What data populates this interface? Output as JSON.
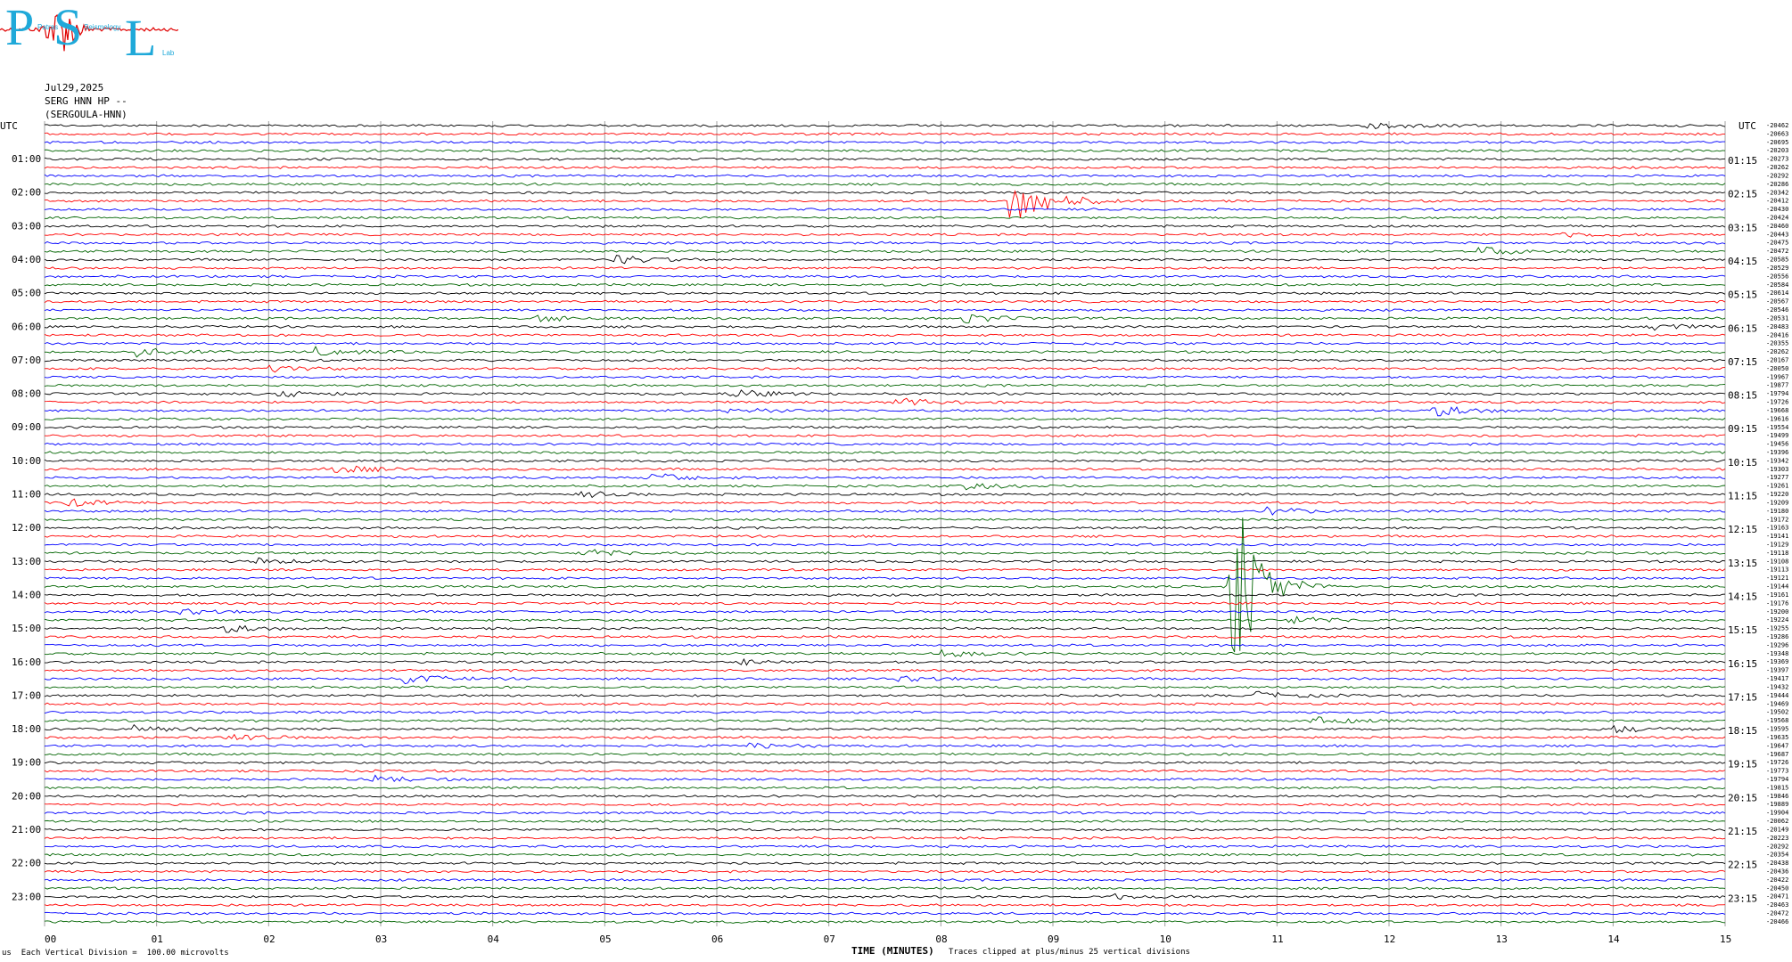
{
  "logo": {
    "letters": [
      "P",
      "S",
      "L"
    ],
    "subtext": [
      "Patras",
      "Seismology",
      "Lab"
    ],
    "colors": {
      "letters": "#1fa9d9",
      "trace": "#e00000"
    }
  },
  "header": {
    "date": "Jul29,2025",
    "station": "SERG HNN HP --",
    "name": "(SERGOULA-HNN)"
  },
  "chart_data": {
    "type": "line",
    "title": "",
    "xlabel": "TIME (MINUTES)",
    "x_ticks": [
      "00",
      "01",
      "02",
      "03",
      "04",
      "05",
      "06",
      "07",
      "08",
      "09",
      "10",
      "11",
      "12",
      "13",
      "14",
      "15"
    ],
    "xlim": [
      0,
      15
    ],
    "left_axis_title": "UTC",
    "right_axis_title": "UTC",
    "left_labels": [
      "01:00",
      "02:00",
      "03:00",
      "04:00",
      "05:00",
      "06:00",
      "07:00",
      "08:00",
      "09:00",
      "10:00",
      "11:00",
      "12:00",
      "13:00",
      "14:00",
      "15:00",
      "16:00",
      "17:00",
      "18:00",
      "19:00",
      "20:00",
      "21:00",
      "22:00",
      "23:00"
    ],
    "right_labels": [
      "01:15",
      "02:15",
      "03:15",
      "04:15",
      "05:15",
      "06:15",
      "07:15",
      "08:15",
      "09:15",
      "10:15",
      "11:15",
      "12:15",
      "13:15",
      "14:15",
      "15:15",
      "16:15",
      "17:15",
      "18:15",
      "19:15",
      "20:15",
      "21:15",
      "22:15",
      "23:15"
    ],
    "trace_colors": [
      "#000000",
      "#ff0000",
      "#0000ff",
      "#006400"
    ],
    "trace_count": 96,
    "right_values": [
      "-20462",
      "-20663",
      "-20695",
      "-20203",
      "-20273",
      "-20262",
      "-20292",
      "-20286",
      "-20342",
      "-20412",
      "-20430",
      "-20424",
      "-20460",
      "-20443",
      "-20475",
      "-20472",
      "-20585",
      "-20529",
      "-20556",
      "-20584",
      "-20614",
      "-20567",
      "-20546",
      "-20531",
      "-20483",
      "-20416",
      "-20355",
      "-20262",
      "-20167",
      "-20050",
      "-19967",
      "-19877",
      "-19794",
      "-19726",
      "-19668",
      "-19616",
      "-19554",
      "-19499",
      "-19456",
      "-19396",
      "-19342",
      "-19303",
      "-19277",
      "-19261",
      "-19220",
      "-19209",
      "-19180",
      "-19172",
      "-19163",
      "-19141",
      "-19129",
      "-19118",
      "-19108",
      "-19113",
      "-19121",
      "-19144",
      "-19161",
      "-19176",
      "-19200",
      "-19224",
      "-19255",
      "-19286",
      "-19296",
      "-19348",
      "-19369",
      "-19397",
      "-19417",
      "-19432",
      "-19444",
      "-19469",
      "-19502",
      "-19568",
      "-19595",
      "-19635",
      "-19647",
      "-19687",
      "-19726",
      "-19773",
      "-19794",
      "-19815",
      "-19846",
      "-19889",
      "-19904",
      "-20062",
      "-20149",
      "-20223",
      "-20292",
      "-20354",
      "-20438",
      "-20436",
      "-20422",
      "-20450",
      "-20471",
      "-20463",
      "-20472",
      "-20466"
    ],
    "events": [
      {
        "trace": 0,
        "minute": 11.82,
        "amp": 4
      },
      {
        "trace": 9,
        "minute": 8.62,
        "amp": 26
      },
      {
        "trace": 13,
        "minute": 13.55,
        "amp": 3
      },
      {
        "trace": 15,
        "minute": 12.8,
        "amp": 5
      },
      {
        "trace": 16,
        "minute": 5.1,
        "amp": 5
      },
      {
        "trace": 23,
        "minute": 8.2,
        "amp": 5
      },
      {
        "trace": 23,
        "minute": 4.4,
        "amp": 4
      },
      {
        "trace": 24,
        "minute": 14.3,
        "amp": 4
      },
      {
        "trace": 27,
        "minute": 0.8,
        "amp": 5
      },
      {
        "trace": 27,
        "minute": 2.4,
        "amp": 5
      },
      {
        "trace": 29,
        "minute": 2.0,
        "amp": 4
      },
      {
        "trace": 32,
        "minute": 2.1,
        "amp": 4
      },
      {
        "trace": 32,
        "minute": 6.1,
        "amp": 5
      },
      {
        "trace": 33,
        "minute": 7.6,
        "amp": 4
      },
      {
        "trace": 34,
        "minute": 6.1,
        "amp": 3
      },
      {
        "trace": 34,
        "minute": 12.4,
        "amp": 6
      },
      {
        "trace": 41,
        "minute": 2.5,
        "amp": 6
      },
      {
        "trace": 42,
        "minute": 5.4,
        "amp": 5
      },
      {
        "trace": 43,
        "minute": 8.2,
        "amp": 4
      },
      {
        "trace": 44,
        "minute": 4.8,
        "amp": 3
      },
      {
        "trace": 45,
        "minute": 0.2,
        "amp": 4
      },
      {
        "trace": 46,
        "minute": 10.9,
        "amp": 4
      },
      {
        "trace": 51,
        "minute": 4.8,
        "amp": 4
      },
      {
        "trace": 52,
        "minute": 1.9,
        "amp": 3
      },
      {
        "trace": 55,
        "minute": 10.6,
        "amp": 150
      },
      {
        "trace": 58,
        "minute": 1.2,
        "amp": 3
      },
      {
        "trace": 59,
        "minute": 11.1,
        "amp": 4
      },
      {
        "trace": 60,
        "minute": 1.6,
        "amp": 4
      },
      {
        "trace": 63,
        "minute": 8.0,
        "amp": 4
      },
      {
        "trace": 64,
        "minute": 6.2,
        "amp": 3
      },
      {
        "trace": 66,
        "minute": 3.2,
        "amp": 5
      },
      {
        "trace": 66,
        "minute": 7.6,
        "amp": 3
      },
      {
        "trace": 68,
        "minute": 10.8,
        "amp": 4
      },
      {
        "trace": 71,
        "minute": 11.3,
        "amp": 4
      },
      {
        "trace": 72,
        "minute": 0.8,
        "amp": 4
      },
      {
        "trace": 72,
        "minute": 13.9,
        "amp": 5
      },
      {
        "trace": 73,
        "minute": 1.6,
        "amp": 5
      },
      {
        "trace": 74,
        "minute": 6.3,
        "amp": 3
      },
      {
        "trace": 78,
        "minute": 2.9,
        "amp": 4
      },
      {
        "trace": 92,
        "minute": 9.5,
        "amp": 3
      }
    ]
  },
  "footer": {
    "left_prefix": "us",
    "scale_text": "Each Vertical Division =  100.00 microvolts",
    "clip_text": "Traces clipped at plus/minus 25 vertical divisions"
  }
}
